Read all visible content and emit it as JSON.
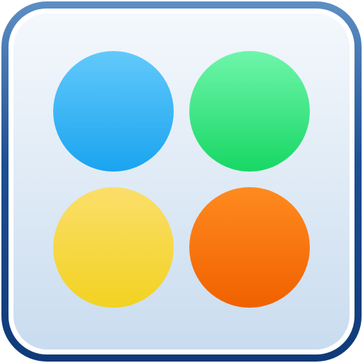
{
  "app_icon": {
    "name": "four-color-dots-app-icon",
    "frame_color": "#1d4f93",
    "plate_color": "#dde9f5",
    "dots": [
      {
        "name": "blue",
        "color": "#1aa4ef"
      },
      {
        "name": "green",
        "color": "#17d764"
      },
      {
        "name": "yellow",
        "color": "#f2d221"
      },
      {
        "name": "orange",
        "color": "#f06100"
      }
    ]
  }
}
